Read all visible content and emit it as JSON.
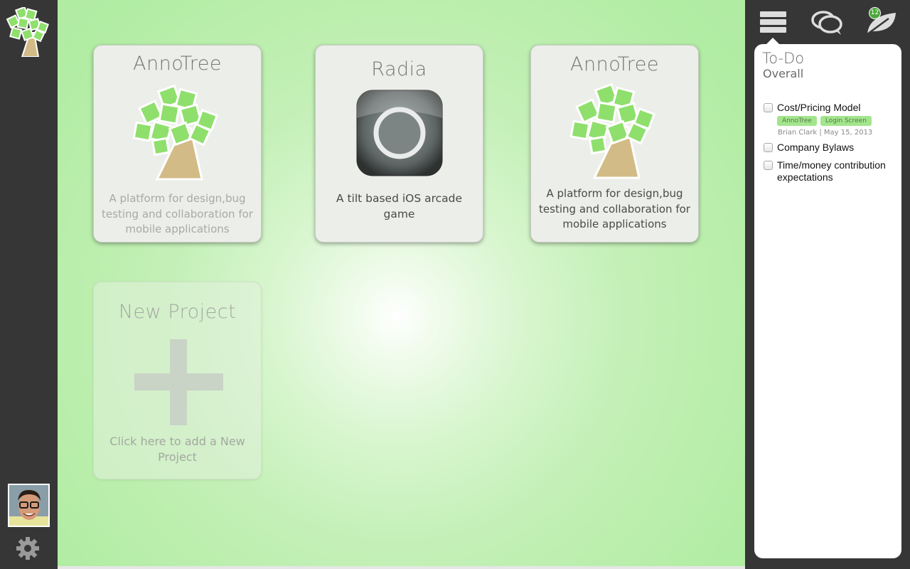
{
  "projects": [
    {
      "title": "AnnoTree",
      "description": "A platform for design,bug testing and collaboration for mobile applications",
      "icon": "tree-icon"
    },
    {
      "title": "Radia",
      "description": "A tilt based iOS arcade game",
      "icon": "radia-app-icon"
    },
    {
      "title": "AnnoTree",
      "description": "A platform for design,bug testing and collaboration for mobile applications",
      "icon": "tree-icon"
    }
  ],
  "new_project": {
    "title": "New Project",
    "description": "Click here to add a New Project",
    "icon": "plus-icon"
  },
  "right_panel": {
    "tabs": [
      {
        "icon": "list-icon",
        "active": true
      },
      {
        "icon": "chat-icon"
      },
      {
        "icon": "leaf-icon",
        "badge": "12"
      }
    ],
    "title": "To-Do",
    "subtitle": "Overall",
    "todos": [
      {
        "label": "Cost/Pricing Model",
        "tags": [
          "AnnoTree",
          "Login Screen"
        ],
        "meta": "Brian Clark | May 15, 2013"
      },
      {
        "label": "Company Bylaws"
      },
      {
        "label": "Time/money contribution  expectations"
      }
    ]
  },
  "left_bar": {
    "logo_icon": "annotree-logo-icon",
    "avatar_icon": "user-avatar",
    "settings_icon": "gear-icon"
  },
  "colors": {
    "background_green": "#b3eda5",
    "tag_green": "#a3e58d",
    "sidebar": "#363636",
    "badge": "#4ca63c"
  }
}
